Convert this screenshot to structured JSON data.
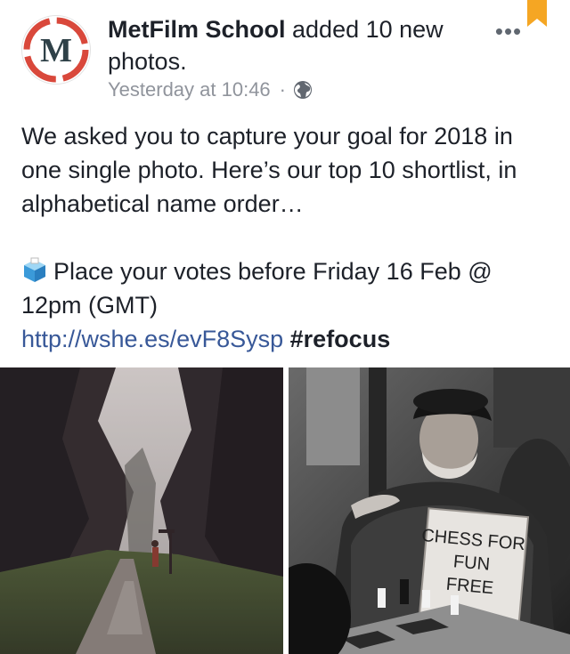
{
  "post": {
    "page_name": "MetFilm School",
    "action_text": " added 10 new photos.",
    "timestamp": "Yesterday at 10:46",
    "separator": "·",
    "avatar_letter": "M",
    "more_label": "•••",
    "privacy_icon": "globe-icon",
    "colors": {
      "accent": "#385898",
      "logo_red": "#d9483b",
      "logo_dark": "#2f4148",
      "bookmark": "#f5a623"
    }
  },
  "body": {
    "line1": "We asked you to capture your goal for 2018 in one single photo. Here’s our top 10 shortlist, in alphabetical name order…",
    "vote_text": "Place your votes before Friday 16 Feb @ 12pm (GMT)",
    "link": "http://wshe.es/evF8Sysp",
    "hashtag": "#refocus"
  },
  "photos": [
    {
      "subject": "misty forest path with a person"
    },
    {
      "subject": "man playing chess",
      "sign_lines": [
        "CHESS FOR",
        "FUN",
        "FREE"
      ]
    }
  ]
}
